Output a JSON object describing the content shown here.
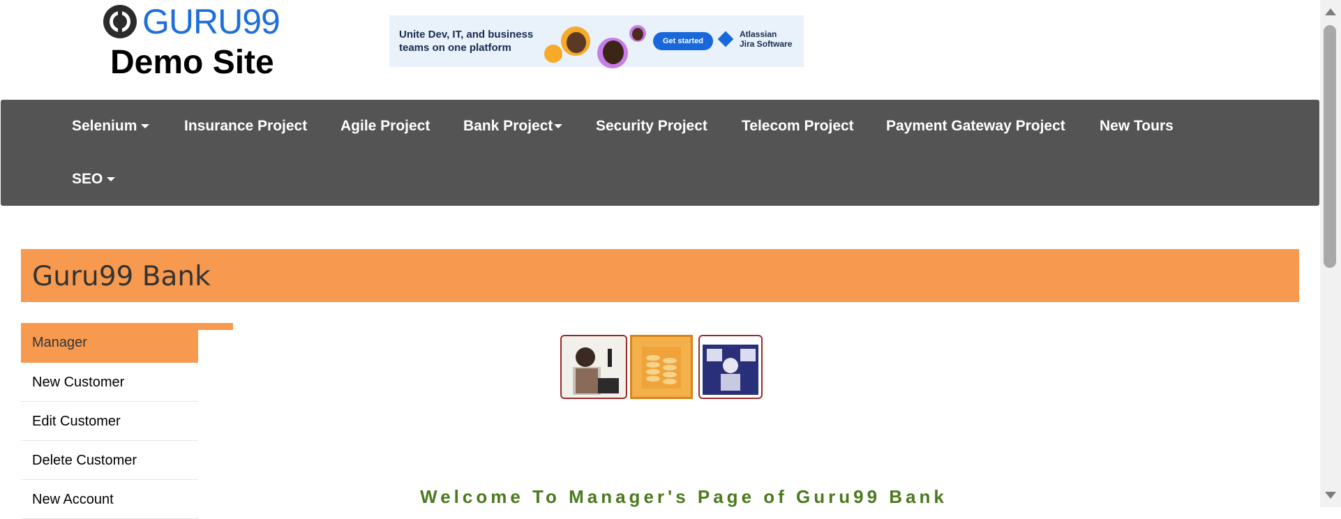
{
  "header": {
    "logo_text": "GURU99",
    "site_title": "Demo Site"
  },
  "ad": {
    "headline": "Unite Dev, IT, and business teams on one platform",
    "cta": "Get started",
    "brand_line1": "Atlassian",
    "brand_line2": "Jira Software",
    "colors": {
      "background": "#e9f1fb",
      "button": "#1868db"
    }
  },
  "nav": {
    "items": [
      {
        "label": "Selenium",
        "dropdown": true
      },
      {
        "label": "Insurance Project",
        "dropdown": false
      },
      {
        "label": "Agile Project",
        "dropdown": false
      },
      {
        "label": "Bank Project",
        "dropdown": true
      },
      {
        "label": "Security Project",
        "dropdown": false
      },
      {
        "label": "Telecom Project",
        "dropdown": false
      },
      {
        "label": "Payment Gateway Project",
        "dropdown": false
      },
      {
        "label": "New Tours",
        "dropdown": false
      },
      {
        "label": "SEO",
        "dropdown": true
      }
    ],
    "colors": {
      "background": "#545454",
      "text": "#ffffff"
    }
  },
  "bank": {
    "title": "Guru99 Bank",
    "colors": {
      "accent": "#f79a50"
    }
  },
  "menu": {
    "items": [
      {
        "label": "Manager",
        "active": true
      },
      {
        "label": "New Customer",
        "active": false
      },
      {
        "label": "Edit Customer",
        "active": false
      },
      {
        "label": "Delete Customer",
        "active": false
      },
      {
        "label": "New Account",
        "active": false
      }
    ]
  },
  "welcome": {
    "text": "Welcome To Manager's Page of Guru99 Bank",
    "color": "#4a7a1c"
  }
}
